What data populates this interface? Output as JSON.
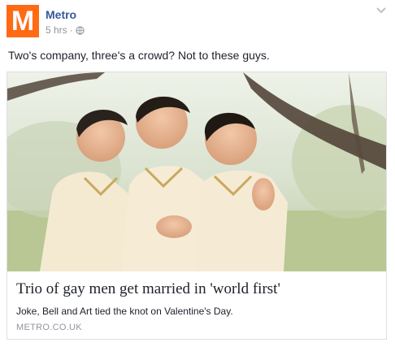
{
  "post": {
    "page_name": "Metro",
    "avatar_letter": "M",
    "timestamp": "5 hrs",
    "separator": "·",
    "audience_icon": "globe-icon",
    "menu_icon": "chevron-down-icon",
    "text": "Two's company, three's a crowd? Not to these guys."
  },
  "link": {
    "image": "three-grooms-embracing-photo",
    "title": "Trio of gay men get married in 'world first'",
    "description": "Joke, Bell and Art tied the knot on Valentine's Day.",
    "domain": "METRO.CO.UK"
  },
  "colors": {
    "brand": "#ff6a13",
    "page_name": "#365899",
    "meta": "#90949c"
  }
}
